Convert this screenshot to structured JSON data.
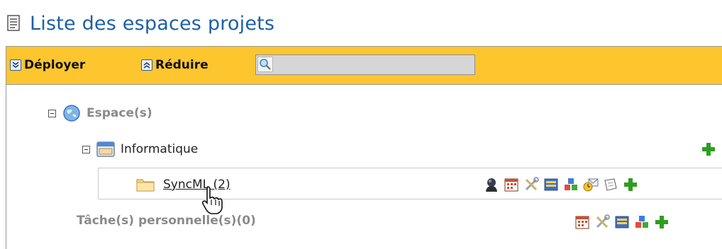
{
  "page": {
    "title": "Liste des espaces projets"
  },
  "toolbar": {
    "expand_label": "Déployer",
    "collapse_label": "Réduire",
    "search_value": ""
  },
  "tree": {
    "root_label": "Espace(s)",
    "space_label": "Informatique",
    "project_label": "SyncML (2)",
    "personal_tasks_label": "Tâche(s) personnelle(s)(0)"
  },
  "colors": {
    "accent_blue": "#1d5fa6",
    "toolbar_bg": "#fdc62f",
    "grey_text": "#8a8a8a",
    "add_green": "#2e9e1f"
  },
  "icons": {
    "project_actions": [
      "member-icon",
      "calendar-icon",
      "tools-icon",
      "list-icon",
      "cubes-icon",
      "timer-mail-icon",
      "note-icon",
      "add-icon"
    ],
    "personal_actions": [
      "calendar-icon",
      "tools-icon",
      "list-icon",
      "cubes-icon",
      "add-icon"
    ]
  }
}
